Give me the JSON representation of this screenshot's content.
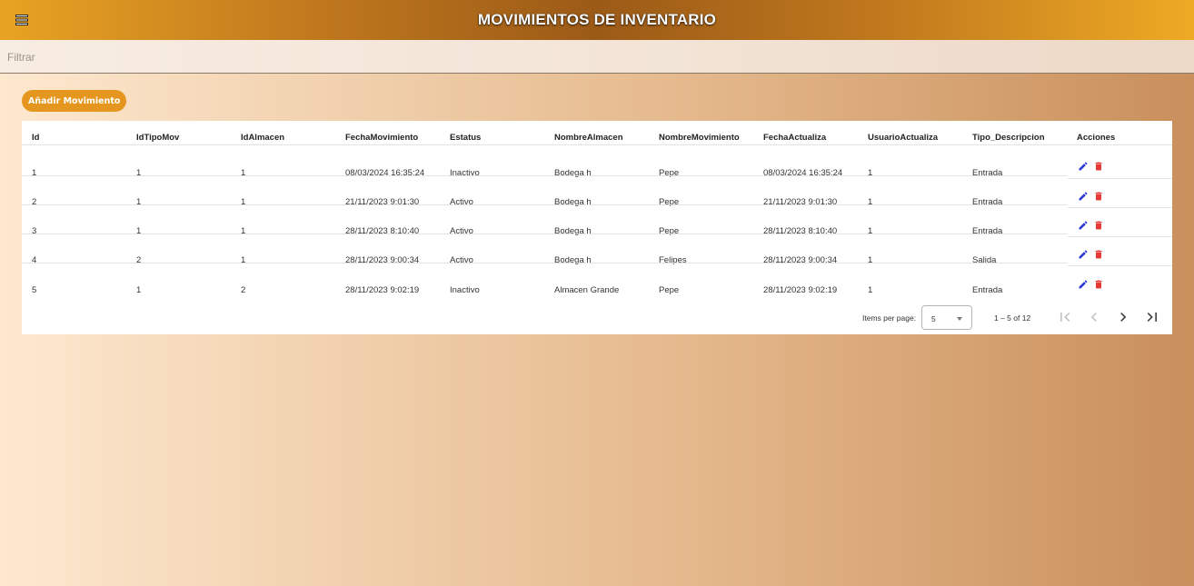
{
  "header": {
    "title": "MOVIMIENTOS DE INVENTARIO",
    "menu_icon": "hamburger-menu-icon"
  },
  "filter": {
    "placeholder": "Filtrar",
    "value": ""
  },
  "toolbar": {
    "add_label": "Añadir Movimiento"
  },
  "table": {
    "columns": [
      "Id",
      "IdTipoMov",
      "IdAlmacen",
      "FechaMovimiento",
      "Estatus",
      "NombreAlmacen",
      "NombreMovimiento",
      "FechaActualiza",
      "UsuarioActualiza",
      "Tipo_Descripcion",
      "Acciones"
    ],
    "rows": [
      [
        "1",
        "1",
        "1",
        "08/03/2024 16:35:24",
        "Inactivo",
        "Bodega h",
        "Pepe",
        "08/03/2024 16:35:24",
        "1",
        "Entrada"
      ],
      [
        "2",
        "1",
        "1",
        "21/11/2023 9:01:30",
        "Activo",
        "Bodega h",
        "Pepe",
        "21/11/2023 9:01:30",
        "1",
        "Entrada"
      ],
      [
        "3",
        "1",
        "1",
        "28/11/2023 8:10:40",
        "Activo",
        "Bodega h",
        "Pepe",
        "28/11/2023 8:10:40",
        "1",
        "Entrada"
      ],
      [
        "4",
        "2",
        "1",
        "28/11/2023 9:00:34",
        "Activo",
        "Bodega h",
        "Felipes",
        "28/11/2023 9:00:34",
        "1",
        "Salida"
      ],
      [
        "5",
        "1",
        "2",
        "28/11/2023 9:02:19",
        "Inactivo",
        "Almacen Grande",
        "Pepe",
        "28/11/2023 9:02:19",
        "1",
        "Entrada"
      ]
    ],
    "action_icons": [
      "edit-pencil-icon",
      "delete-trash-icon"
    ]
  },
  "paginator": {
    "items_per_page_label": "Items per page:",
    "page_size": "5",
    "range_label": "1 – 5 of 12",
    "icons": [
      "first-page-icon",
      "previous-page-icon",
      "next-page-icon",
      "last-page-icon"
    ]
  },
  "colors": {
    "accent": "#e5961e",
    "edit_icon": "#2c3bd6",
    "delete_icon": "#e53935"
  }
}
